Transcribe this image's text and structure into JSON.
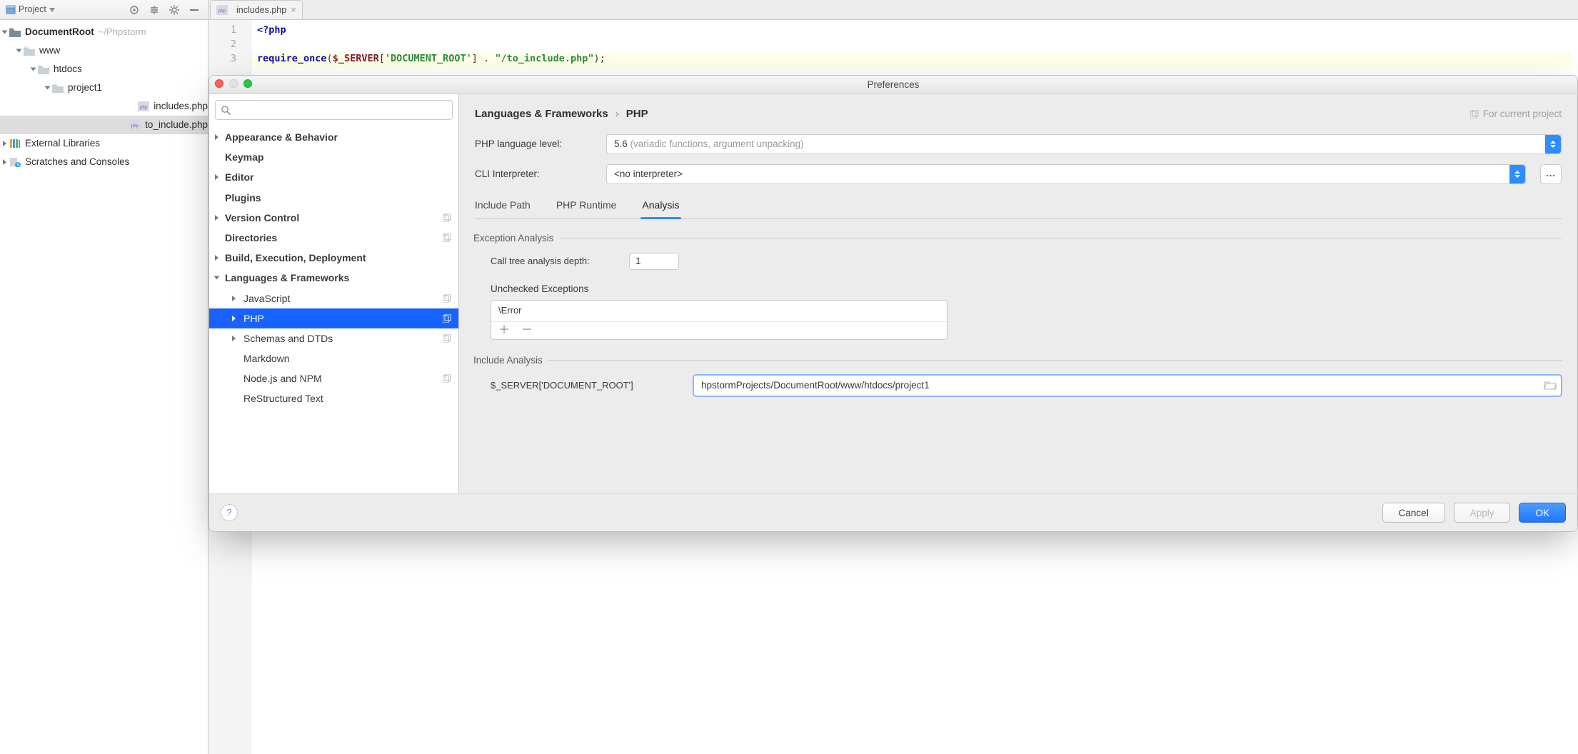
{
  "projectToolbar": {
    "title": "Project"
  },
  "tree": {
    "root": {
      "label": "DocumentRoot",
      "hint": "~/Phpstorm"
    },
    "www": "www",
    "htdocs": "htdocs",
    "project1": "project1",
    "file1": "includes.php",
    "file2": "to_include.php",
    "ext": "External Libraries",
    "scr": "Scratches and Consoles"
  },
  "editor": {
    "tab": "includes.php",
    "lines": [
      "1",
      "2",
      "3"
    ],
    "code": {
      "l1_kw": "<?php",
      "l3_fn": "require_once",
      "l3_p1": "(",
      "l3_var": "$_SERVER",
      "l3_b1": "[",
      "l3_s1": "'DOCUMENT_ROOT'",
      "l3_b2": "]",
      "l3_mid": " . ",
      "l3_s2": "\"/to_include.php\"",
      "l3_end": ");"
    }
  },
  "prefs": {
    "title": "Preferences",
    "search_placeholder": "",
    "categories": {
      "appearance": "Appearance & Behavior",
      "keymap": "Keymap",
      "editor": "Editor",
      "plugins": "Plugins",
      "vcs": "Version Control",
      "directories": "Directories",
      "build": "Build, Execution, Deployment",
      "langfw": "Languages & Frameworks",
      "js": "JavaScript",
      "php": "PHP",
      "schemas": "Schemas and DTDs",
      "markdown": "Markdown",
      "node": "Node.js and NPM",
      "rst": "ReStructured Text"
    },
    "crumb1": "Languages & Frameworks",
    "crumb2": "PHP",
    "curproj": "For current project",
    "php_level_lbl": "PHP language level:",
    "php_level_val": "5.6",
    "php_level_hint": "(variadic functions, argument unpacking)",
    "cli_lbl": "CLI Interpreter:",
    "cli_val": "<no interpreter>",
    "tabs": {
      "include": "Include Path",
      "runtime": "PHP Runtime",
      "analysis": "Analysis"
    },
    "exc_group": "Exception Analysis",
    "depth_lbl": "Call tree analysis depth:",
    "depth_val": "1",
    "unchecked_lbl": "Unchecked Exceptions",
    "unchecked_item": "\\Error",
    "inc_group": "Include Analysis",
    "docroot_lbl": "$_SERVER['DOCUMENT_ROOT']",
    "docroot_val": "hpstormProjects/DocumentRoot/www/htdocs/project1",
    "buttons": {
      "cancel": "Cancel",
      "apply": "Apply",
      "ok": "OK"
    }
  }
}
